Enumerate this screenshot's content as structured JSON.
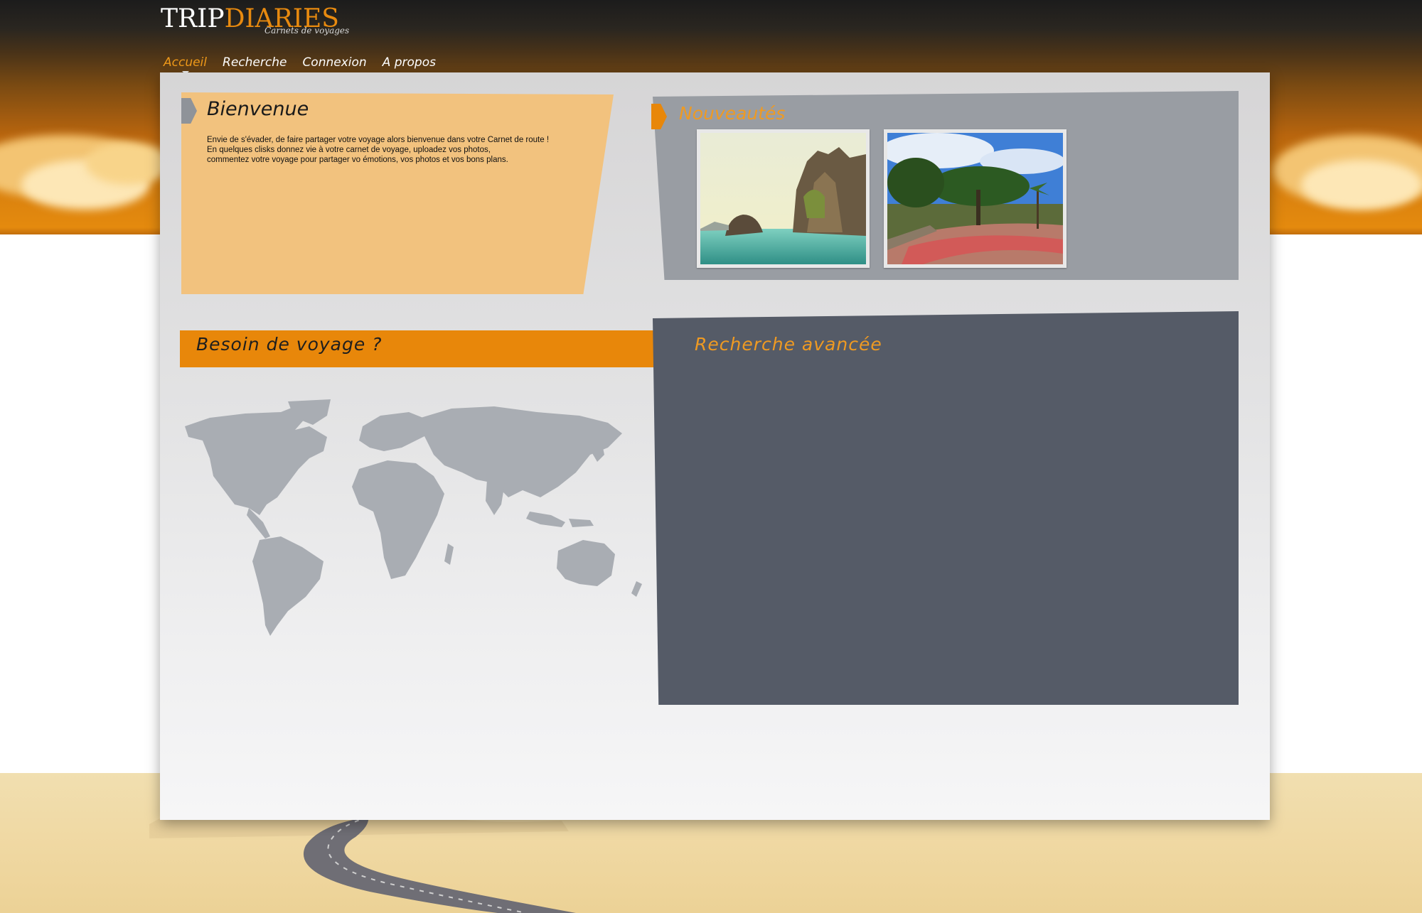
{
  "header": {
    "logo_trip": "TRIP",
    "logo_diaries": "DIARIES",
    "tagline": "Carnets de voyages"
  },
  "nav": {
    "items": [
      {
        "label": "Accueil",
        "active": true
      },
      {
        "label": "Recherche",
        "active": false
      },
      {
        "label": "Connexion",
        "active": false
      },
      {
        "label": "A propos",
        "active": false
      }
    ]
  },
  "welcome": {
    "title": "Bienvenue",
    "lines": [
      "Envie de s'évader, de faire partager votre voyage alors bienvenue dans votre Carnet de route !",
      "En quelques clisks donnez vie à votre carnet de voyage, uploadez vos photos,",
      "commentez votre voyage pour partager vo émotions, vos photos et vos bons plans."
    ]
  },
  "news": {
    "title": "Nouveautés",
    "photos": [
      {
        "name": "lagoon-cliffs-photo"
      },
      {
        "name": "park-trees-photo"
      }
    ]
  },
  "travel": {
    "title": "Besoin de voyage ?"
  },
  "advanced_search": {
    "title": "Recherche avancée"
  },
  "colors": {
    "accent": "#e8870a",
    "welcome_bg": "#f2c27e",
    "news_bg": "#999da3",
    "search_bg": "#555b67"
  }
}
